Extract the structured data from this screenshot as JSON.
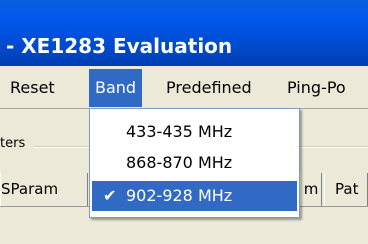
{
  "window": {
    "title": "- XE1283 Evaluation"
  },
  "menubar": {
    "items": [
      {
        "id": "reset",
        "label": "Reset"
      },
      {
        "id": "band",
        "label": "Band"
      },
      {
        "id": "predefined",
        "label": "Predefined"
      },
      {
        "id": "pingpong",
        "label": "Ping-Po"
      }
    ]
  },
  "band_menu": {
    "options": [
      {
        "label": "433-435 MHz",
        "checked": false
      },
      {
        "label": "868-870 MHz",
        "checked": false
      },
      {
        "label": "902-928 MHz",
        "checked": true
      }
    ],
    "check_glyph": "✔"
  },
  "group": {
    "label": "ters"
  },
  "tabs": [
    {
      "label": "SParam"
    },
    {
      "label": "m"
    },
    {
      "label": "Pat"
    }
  ],
  "colors": {
    "titlebar": "#0058ee",
    "menu_highlight": "#316ac5",
    "background": "#ece9d8"
  }
}
